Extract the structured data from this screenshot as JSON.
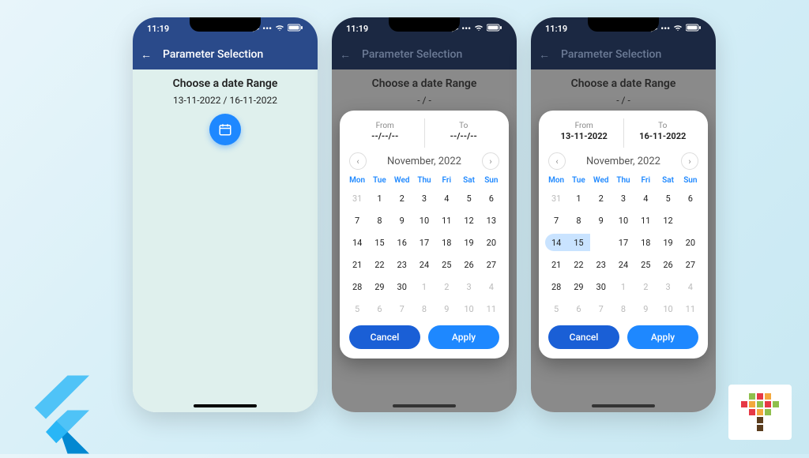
{
  "status": {
    "time": "11:19",
    "signal": "•••",
    "wifi": "wifi",
    "battery": "batt"
  },
  "app": {
    "title": "Parameter Selection",
    "back": "←"
  },
  "main": {
    "choose_label": "Choose a date Range",
    "selected_range": "13-11-2022 / 16-11-2022",
    "placeholder_range": "- / -"
  },
  "calendar": {
    "from_label": "From",
    "to_label": "To",
    "empty_date": "--/--/--",
    "from_value": "13-11-2022",
    "to_value": "16-11-2022",
    "month_label": "November, 2022",
    "prev": "‹",
    "next": "›",
    "day_headers": [
      "Mon",
      "Tue",
      "Wed",
      "Thu",
      "Fri",
      "Sat",
      "Sun"
    ],
    "cancel": "Cancel",
    "apply": "Apply",
    "grid": [
      [
        "31",
        "1",
        "2",
        "3",
        "4",
        "5",
        "6"
      ],
      [
        "7",
        "8",
        "9",
        "10",
        "11",
        "12",
        "13"
      ],
      [
        "14",
        "15",
        "16",
        "17",
        "18",
        "19",
        "20"
      ],
      [
        "21",
        "22",
        "23",
        "24",
        "25",
        "26",
        "27"
      ],
      [
        "28",
        "29",
        "30",
        "1",
        "2",
        "3",
        "4"
      ],
      [
        "5",
        "6",
        "7",
        "8",
        "9",
        "10",
        "11"
      ]
    ],
    "muted_idx_first_row": [
      0
    ],
    "muted_rows_tail": [
      [
        4,
        3
      ],
      [
        5,
        0
      ]
    ]
  },
  "selection": {
    "start": 13,
    "end": 16
  },
  "colors": {
    "primary": "#1e88ff",
    "header_light": "#2a4a8a",
    "header_dark": "#1b2842"
  }
}
